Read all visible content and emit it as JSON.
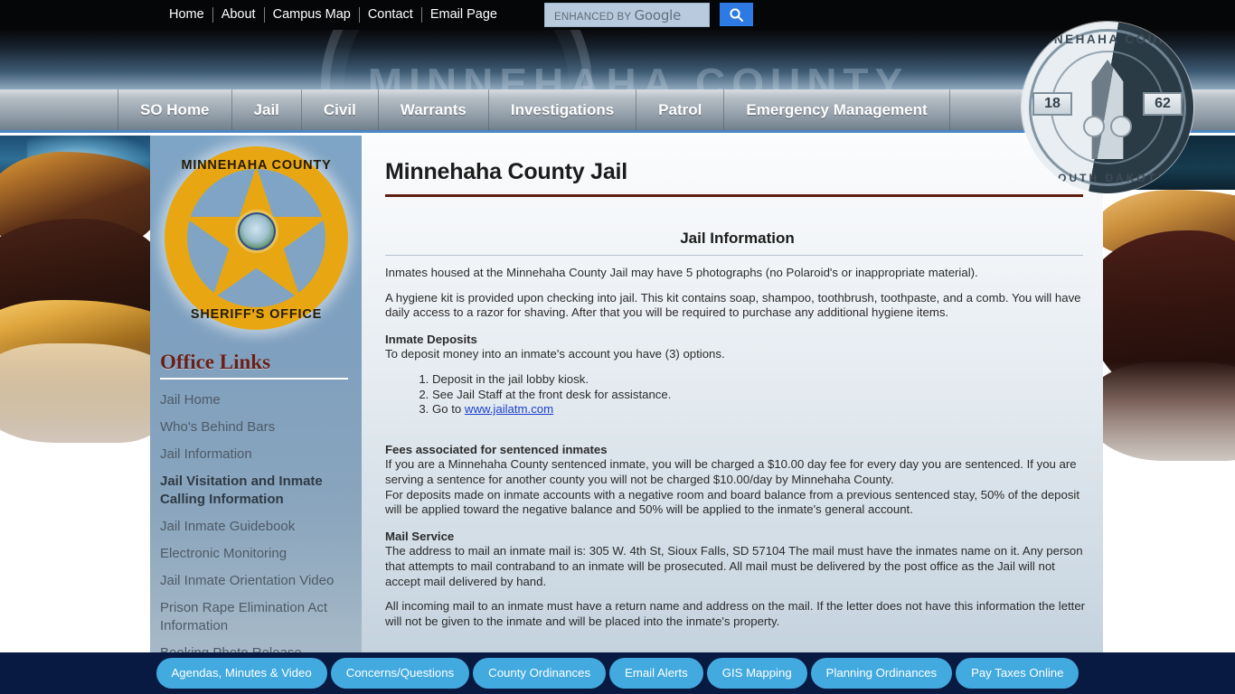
{
  "topbar": {
    "links": [
      "Home",
      "About",
      "Campus Map",
      "Contact",
      "Email Page"
    ],
    "search": {
      "placeholder_small": "ENHANCED BY",
      "placeholder_brand": "Google",
      "button_icon": "search-icon"
    }
  },
  "header": {
    "watermark_text": "MINNEHAHA COUNTY"
  },
  "seal": {
    "top_text": "MINNEHAHA COUNTY",
    "bottom_text": "SOUTH DAKOTA",
    "year_left": "18",
    "year_right": "62"
  },
  "mainnav": {
    "items": [
      "SO Home",
      "Jail",
      "Civil",
      "Warrants",
      "Investigations",
      "Patrol",
      "Emergency Management"
    ]
  },
  "sidebar": {
    "badge": {
      "top_text": "MINNEHAHA COUNTY",
      "bottom_text": "SHERIFF'S OFFICE"
    },
    "heading": "Office Links",
    "items": [
      {
        "label": "Jail Home",
        "active": false
      },
      {
        "label": "Who's Behind Bars",
        "active": false
      },
      {
        "label": "Jail Information",
        "active": false
      },
      {
        "label": "Jail Visitation and Inmate Calling Information",
        "active": true
      },
      {
        "label": "Jail Inmate Guidebook",
        "active": false
      },
      {
        "label": "Electronic Monitoring",
        "active": false
      },
      {
        "label": "Jail Inmate Orientation Video",
        "active": false
      },
      {
        "label": "Prison Rape Elimination Act Information",
        "active": false
      },
      {
        "label": "Booking Photo Release",
        "active": false
      }
    ]
  },
  "content": {
    "page_title": "Minnehaha County Jail",
    "section_title": "Jail Information",
    "para_photos": "Inmates housed at the Minnehaha County Jail may have 5 photographs (no Polaroid's or inappropriate material).",
    "para_hygiene": "A hygiene kit is provided upon checking into jail. This kit contains soap, shampoo, toothbrush, toothpaste, and a comb. You will have daily access to a razor for shaving. After that you will be required to purchase any additional hygiene items.",
    "deposits_heading": "Inmate Deposits",
    "deposits_intro": "To deposit money into an inmate's account you have (3) options.",
    "deposits_options": [
      "Deposit in the jail lobby kiosk.",
      "See Jail Staff at the front desk for assistance."
    ],
    "deposits_option3_prefix": "Go to ",
    "deposits_option3_link": "www.jailatm.com",
    "fees_heading": "Fees associated for sentenced inmates",
    "fees_para1": "If you are a Minnehaha County sentenced inmate, you will be charged a $10.00 day fee for every day you are sentenced. If you are serving a sentence for another county you will not be charged $10.00/day by Minnehaha County.",
    "fees_para2": "For deposits made on inmate accounts with a negative room and board balance from a previous sentenced stay, 50% of the deposit will be applied toward the negative balance and 50% will be applied to the inmate's general account.",
    "mail_heading": "Mail Service",
    "mail_para1": "The address to mail an inmate mail is: 305 W. 4th St, Sioux Falls, SD 57104 The mail must have the inmates name on it. Any person that attempts to mail contraband to an inmate will be prosecuted. All mail must be delivered by the post office as the Jail will not accept mail delivered by hand.",
    "mail_para2": "All incoming mail to an inmate must have a return name and address on the mail. If the letter does not have this information the letter will not be given to the inmate and will be placed into the inmate's property."
  },
  "footer": {
    "buttons": [
      "Agendas, Minutes & Video",
      "Concerns/Questions",
      "County Ordinances",
      "Email Alerts",
      "GIS Mapping",
      "Planning Ordinances",
      "Pay Taxes Online"
    ]
  },
  "colors": {
    "accent_red": "#5e1f10",
    "badge_gold": "#e8a712",
    "footer_navy": "#091a42",
    "footer_button_blue": "#43aae0",
    "nav_underline_blue": "#4b87c5",
    "link_blue": "#1b3fd0"
  }
}
